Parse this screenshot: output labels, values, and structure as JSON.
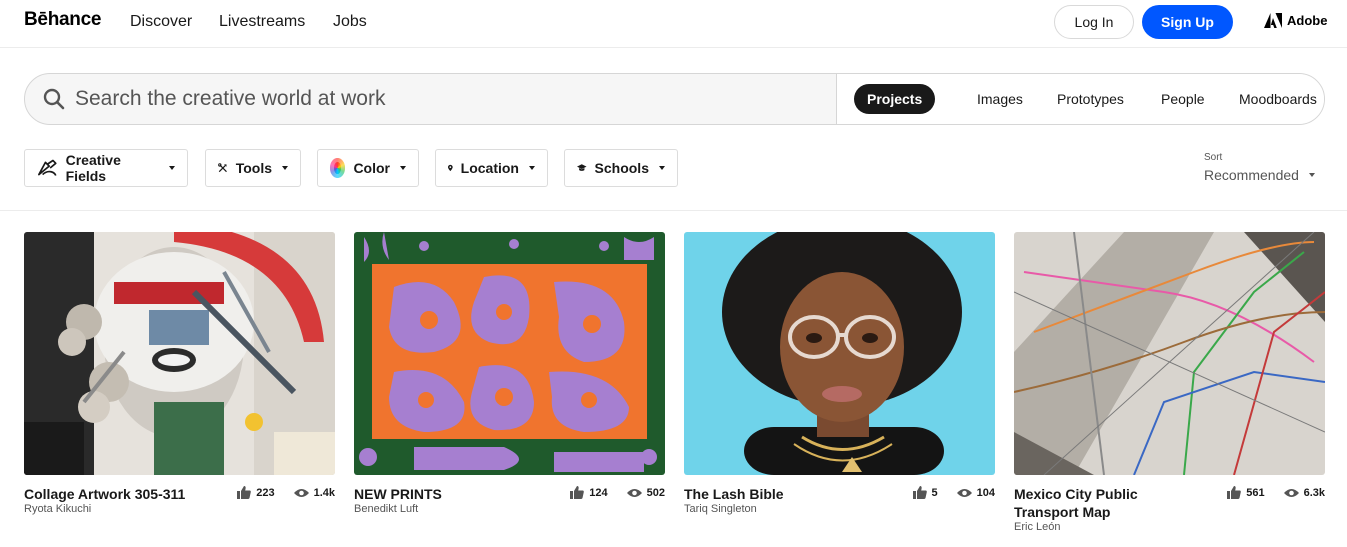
{
  "nav": {
    "logo": "Bēhance",
    "links": [
      "Discover",
      "Livestreams",
      "Jobs"
    ],
    "login": "Log In",
    "signup": "Sign Up",
    "adobe": "Adobe"
  },
  "search": {
    "placeholder": "Search the creative world at work",
    "tabs": [
      "Projects",
      "Images",
      "Prototypes",
      "People",
      "Moodboards"
    ],
    "active_tab": "Projects"
  },
  "filters": {
    "items": [
      "Creative Fields",
      "Tools",
      "Color",
      "Location",
      "Schools"
    ],
    "sort_label": "Sort",
    "sort_value": "Recommended"
  },
  "projects": [
    {
      "title": "Collage Artwork 305-311",
      "owner": "Ryota Kikuchi",
      "likes": "223",
      "views": "1.4k"
    },
    {
      "title": "NEW PRINTS",
      "owner": "Benedikt Luft",
      "likes": "124",
      "views": "502"
    },
    {
      "title": "The Lash Bible",
      "owner": "Tariq Singleton",
      "likes": "5",
      "views": "104"
    },
    {
      "title": "Mexico City Public Transport Map",
      "owner": "Eric León",
      "likes": "561",
      "views": "6.3k"
    }
  ],
  "colors": {
    "accent": "#0057ff",
    "active_tab_bg": "#191919"
  }
}
